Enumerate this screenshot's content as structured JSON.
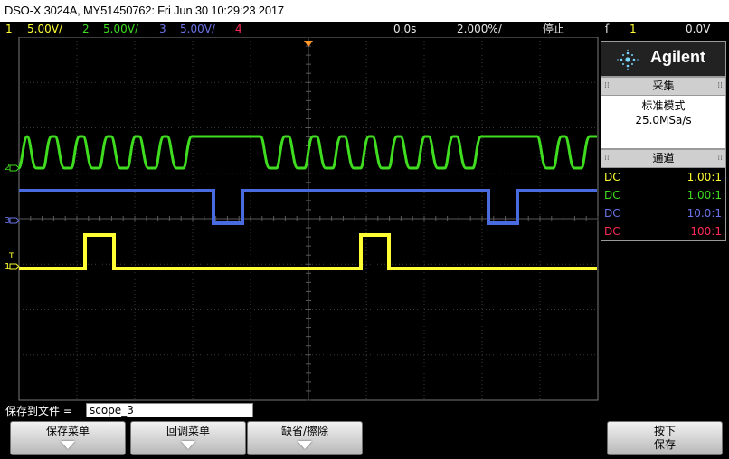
{
  "title": "DSO-X 3024A, MY51450762: Fri Jun 30 10:29:23 2017",
  "status_bar": {
    "ch1": {
      "num": "1",
      "scale": "5.00V/"
    },
    "ch2": {
      "num": "2",
      "scale": "5.00V/"
    },
    "ch3": {
      "num": "3",
      "scale": "5.00V/"
    },
    "ch4": {
      "num": "4"
    },
    "time_offset": "0.0s",
    "time_scale": "2.000%/",
    "run_state": "停止",
    "trigger_icon": "ſ",
    "trigger_source": "1",
    "trigger_level": "0.0V"
  },
  "display": {
    "ground_markers": [
      "2",
      "3",
      "1"
    ],
    "trigger_marker": "T"
  },
  "colors": {
    "ch1": "#ffff33",
    "ch2": "#3fdc20",
    "ch3": "#4a6ae0",
    "ch4": "#ff2a55",
    "grid": "#3a3a3a",
    "trigger_arrow": "#ff9a2a"
  },
  "panel": {
    "brand": "Agilent",
    "brand_icon": "agilent-spark-icon",
    "sampling_header": "采集",
    "sampling_mode": "标准模式",
    "sampling_rate": "25.0MSa/s",
    "channels_header": "通道",
    "channels": [
      {
        "coupling": "DC",
        "ratio": "1.00:1",
        "color": "#ffff33"
      },
      {
        "coupling": "DC",
        "ratio": "1.00:1",
        "color": "#3fdc20"
      },
      {
        "coupling": "DC",
        "ratio": "10.0:1",
        "color": "#6b74e8"
      },
      {
        "coupling": "DC",
        "ratio": "100:1",
        "color": "#ff2a55"
      }
    ]
  },
  "save": {
    "label": "保存到文件 =",
    "filename": "scope_3"
  },
  "softkeys": [
    {
      "label": "保存菜单",
      "sub": ""
    },
    {
      "label": "回调菜单",
      "sub": ""
    },
    {
      "label": "缺省/擦除",
      "sub": ""
    },
    {
      "label": "按下",
      "sub": "保存"
    }
  ]
}
